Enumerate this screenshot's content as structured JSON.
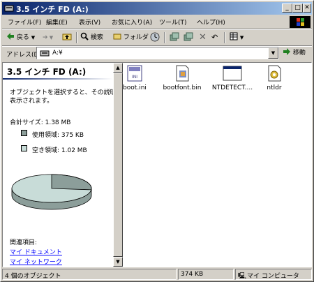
{
  "window": {
    "title": "3.5 インチ FD (A:)",
    "minimize_label": "_",
    "maximize_label": "□",
    "close_label": "✕"
  },
  "menu": [
    "ファイル(F)",
    "編集(E)",
    "表示(V)",
    "お気に入り(A)",
    "ツール(T)",
    "ヘルプ(H)"
  ],
  "toolbar": {
    "back_label": "戻る",
    "search_label": "検索",
    "folders_label": "フォルダ"
  },
  "address": {
    "label": "アドレス(D)",
    "value": "A:¥",
    "go_label": "移動"
  },
  "left_pane": {
    "title": "3.5 インチ FD (A:)",
    "description_line1": "オブジェクトを選択すると、その説明が",
    "description_line2": "表示されます。",
    "total_size": "合計サイズ: 1.38 MB",
    "used_label": "使用領域: 375 KB",
    "free_label": "空き領域: 1.02 MB",
    "related_heading": "関連項目:",
    "links": [
      "マイ ドキュメント",
      "マイ ネットワーク"
    ]
  },
  "disk": {
    "used_fraction": 0.265,
    "used_color": "#8c9e9a",
    "free_color": "#c8dcd8"
  },
  "files": [
    {
      "name": "boot.ini",
      "icon": "ini-settings-icon"
    },
    {
      "name": "bootfont.bin",
      "icon": "system-file-icon"
    },
    {
      "name": "NTDETECT....",
      "icon": "application-window-icon"
    },
    {
      "name": "ntldr",
      "icon": "system-gear-file-icon"
    }
  ],
  "status": {
    "objects": "4 個のオブジェクト",
    "size": "374 KB",
    "location": "マイ コンピュータ"
  }
}
